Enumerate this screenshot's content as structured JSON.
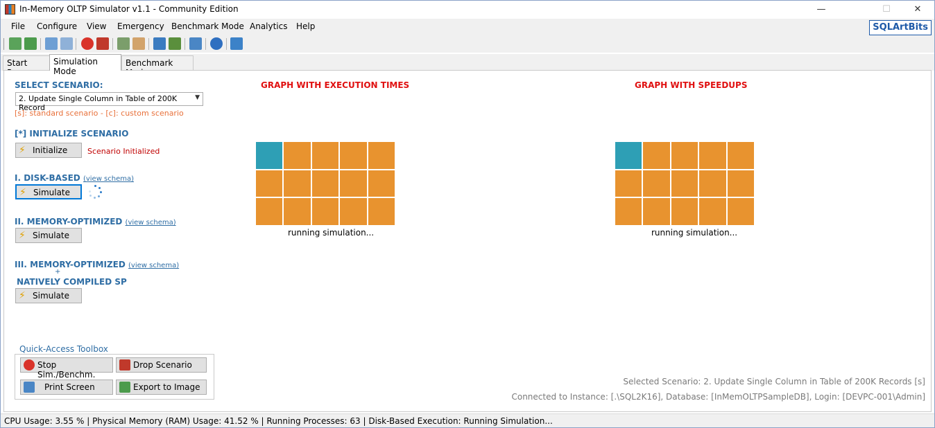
{
  "window": {
    "title": "In-Memory OLTP Simulator v1.1 - Community Edition",
    "minimize": "—",
    "maximize": "☐",
    "close": "✕"
  },
  "menu": {
    "items": [
      {
        "label": "File"
      },
      {
        "label": "Configure"
      },
      {
        "label": "View"
      },
      {
        "label": "Emergency"
      },
      {
        "label": "Benchmark Mode"
      },
      {
        "label": "Analytics"
      },
      {
        "label": "Help"
      }
    ],
    "brand": "SQLArtBits"
  },
  "tabs": [
    {
      "label": "Start Page"
    },
    {
      "label": "Simulation Mode"
    },
    {
      "label": "Benchmark Mode"
    }
  ],
  "scenario": {
    "heading": "SELECT SCENARIO:",
    "selected": "2. Update Single Column in Table of 200K Record",
    "legend": "[s]: standard scenario  -  [c]: custom scenario"
  },
  "init": {
    "heading": "[*] INITIALIZE SCENARIO",
    "button": "Initialize",
    "status": "Scenario Initialized"
  },
  "disk": {
    "heading": "I. DISK-BASED",
    "link": "(view schema)",
    "button": "Simulate"
  },
  "mem": {
    "heading": "II. MEMORY-OPTIMIZED",
    "link": "(view schema)",
    "button": "Simulate"
  },
  "native": {
    "heading": "III. MEMORY-OPTIMIZED",
    "link": "(view schema)",
    "plus": "+",
    "heading2": "NATIVELY COMPILED SP",
    "button": "Simulate"
  },
  "graphs": {
    "exec_title": "GRAPH WITH EXECUTION TIMES",
    "speed_title": "GRAPH WITH SPEEDUPS",
    "exec_caption": "running simulation...",
    "speed_caption": "running simulation..."
  },
  "toolbox": {
    "title": "Quick-Access Toolbox",
    "stop": "Stop Sim./Benchm.",
    "drop": "Drop Scenario",
    "print": "Print Screen",
    "export": "Export to Image"
  },
  "info": {
    "selected_scenario": "Selected Scenario: 2. Update Single Column in Table of 200K Records [s]",
    "connection": "Connected to Instance: [.\\SQL2K16], Database: [InMemOLTPSampleDB], Login: [DEVPC-001\\Admin]"
  },
  "status": {
    "text": "CPU Usage: 3.55 % | Physical Memory (RAM) Usage: 41.52 % | Running Processes: 63  | Disk-Based Execution: Running Simulation..."
  },
  "colors": {
    "accent_blue": "#2e6da4",
    "graph_title_red": "#e01010",
    "tile_orange": "#e8932f",
    "tile_teal": "#2e9fb5",
    "note_orange": "#e8703a"
  }
}
